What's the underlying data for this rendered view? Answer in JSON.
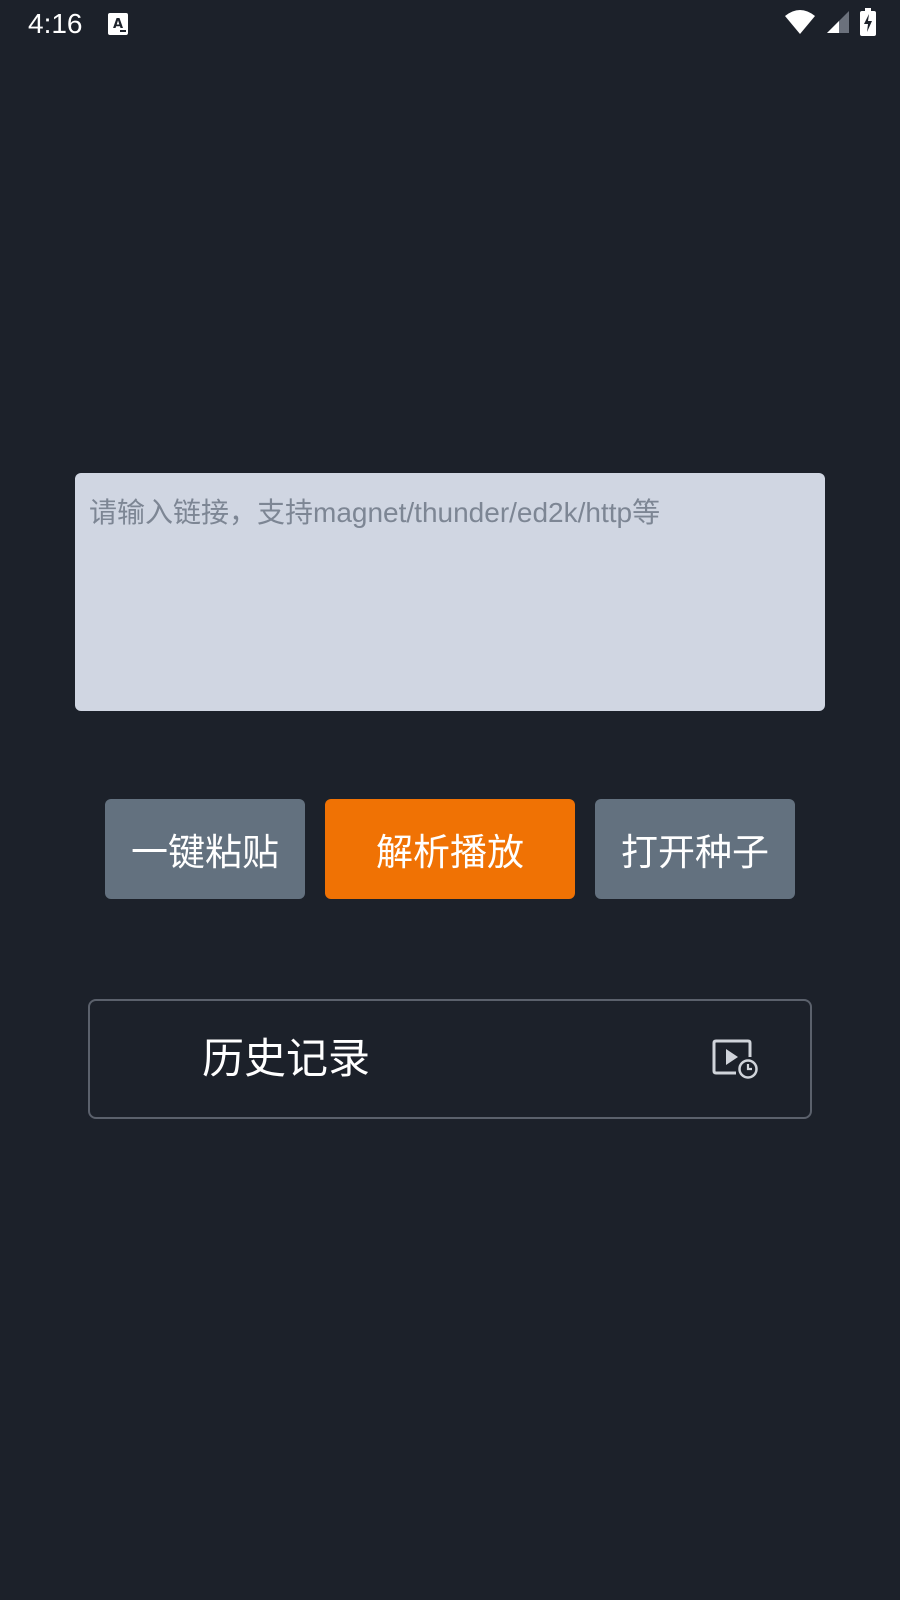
{
  "status_bar": {
    "time": "4:16",
    "icons": [
      "a-notification-icon",
      "wifi-icon",
      "cell-signal-icon",
      "battery-charging-icon"
    ]
  },
  "link_input": {
    "placeholder": "请输入链接，支持magnet/thunder/ed2k/http等",
    "value": ""
  },
  "buttons": {
    "paste": "一键粘贴",
    "parse_play": "解析播放",
    "open_torrent": "打开种子"
  },
  "history": {
    "label": "历史记录",
    "icon": "play-history-icon"
  },
  "colors": {
    "background": "#1c212a",
    "input_bg": "#d0d6e2",
    "secondary_button": "#63717f",
    "accent": "#f07204",
    "outline": "#5b616c"
  }
}
